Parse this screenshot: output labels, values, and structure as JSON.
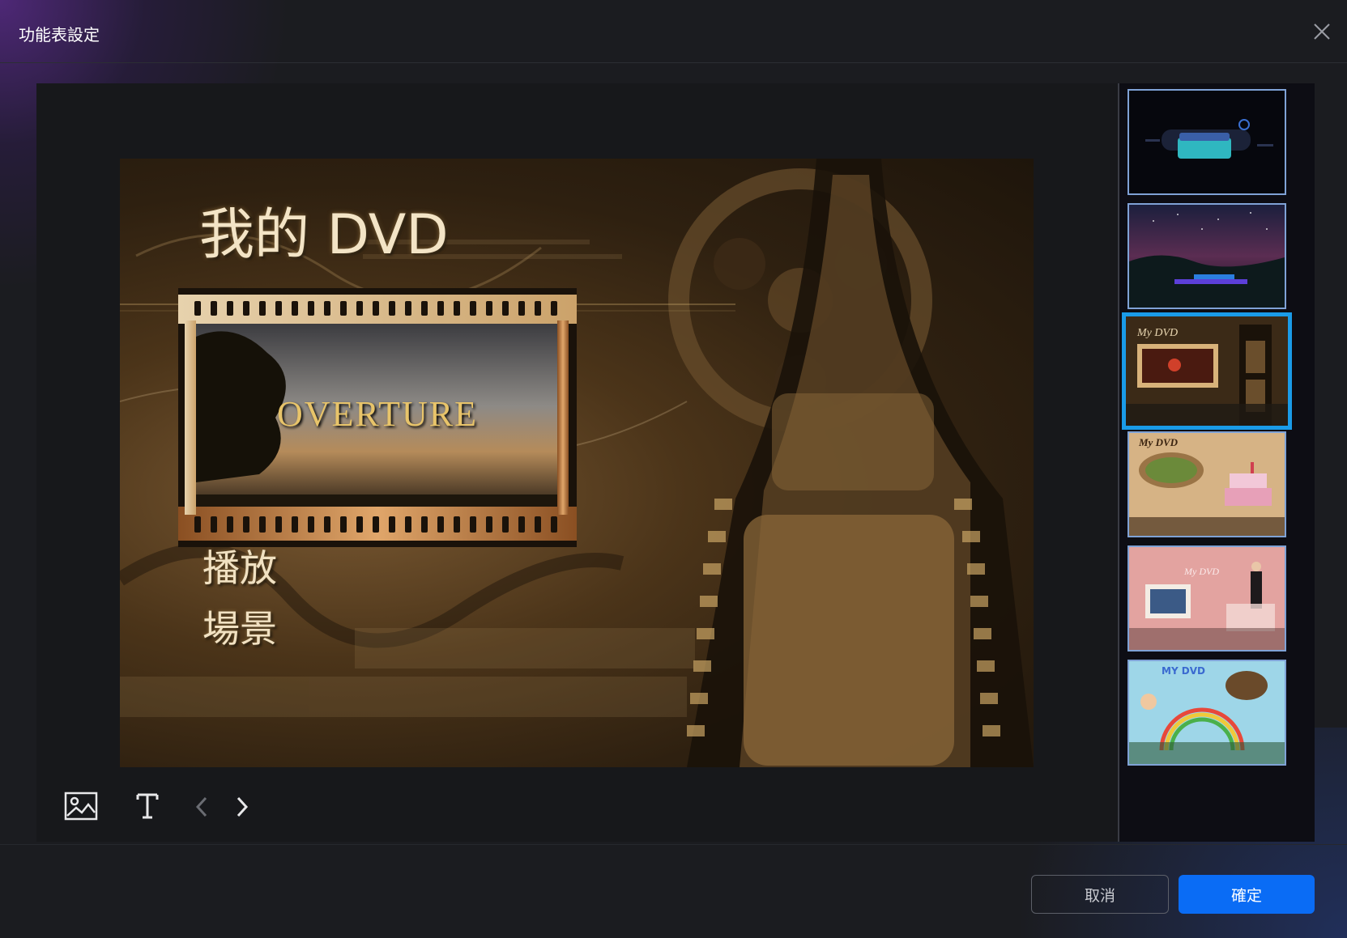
{
  "dialog": {
    "title": "功能表設定"
  },
  "preview": {
    "disc_title": "我的 DVD",
    "overture_text": "OVERTURE",
    "menu_items": [
      "播放",
      "場景"
    ]
  },
  "toolbar": {
    "icons": [
      "image-icon",
      "text-icon",
      "chevron-left-icon",
      "chevron-right-icon"
    ]
  },
  "templates": {
    "selected_index": 2,
    "items": [
      {
        "theme": "dark-tech"
      },
      {
        "theme": "night-sky"
      },
      {
        "theme": "film",
        "text": "My DVD"
      },
      {
        "theme": "birthday",
        "text": "My DVD"
      },
      {
        "theme": "wedding",
        "text": "My DVD"
      },
      {
        "theme": "kids",
        "text": "MY DVD"
      }
    ]
  },
  "footer": {
    "cancel_label": "取消",
    "ok_label": "確定"
  },
  "colors": {
    "accent": "#0a6cf5",
    "selected_border": "#1a9be8",
    "background": "#1b1c20"
  }
}
